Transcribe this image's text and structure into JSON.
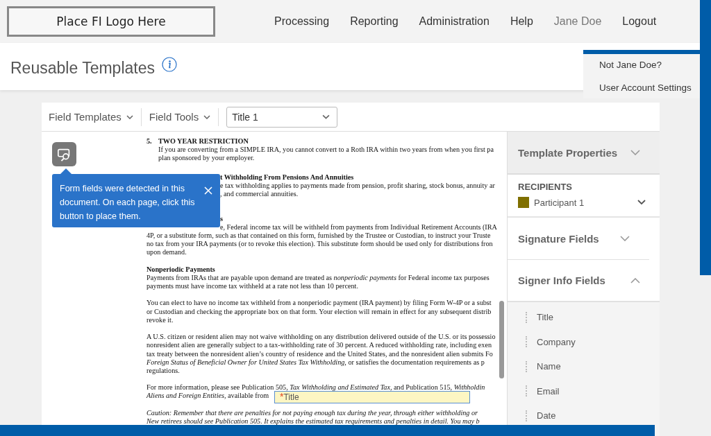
{
  "logo": "Place FI Logo Here",
  "nav": [
    {
      "label": "Processing",
      "selected": false
    },
    {
      "label": "Reporting",
      "selected": false
    },
    {
      "label": "Administration",
      "selected": false
    },
    {
      "label": "Help",
      "selected": false
    },
    {
      "label": "Jane Doe",
      "selected": true
    },
    {
      "label": "Logout",
      "selected": false
    }
  ],
  "user_menu": [
    "Not Jane Doe?",
    "User Account Settings"
  ],
  "page_title": "Reusable Templates",
  "toolbar": {
    "menus": [
      "Field Templates",
      "Field Tools"
    ],
    "select_value": "Title 1"
  },
  "detect_tip": "Form fields were detected in this document. On each page, click this button to place them.",
  "document": [
    {
      "lines": [
        {
          "kind": "heading",
          "num": "5.",
          "text": "TWO YEAR RESTRICTION"
        },
        {
          "kind": "indent",
          "text": "If you are converting from a SIMPLE IRA, you cannot convert to a Roth IRA within two years from when you first pa"
        },
        {
          "kind": "indent",
          "text": "plan sponsored by your employer."
        }
      ]
    },
    {
      "lines": [
        {
          "kind": "covered-bold",
          "text": "t Withholding From Pensions And Annuities"
        },
        {
          "kind": "covered",
          "text": "e tax withholding applies to payments made from pension, profit sharing, stock bonus, annuity ar"
        },
        {
          "kind": "covered",
          "text": ", and commercial annuities."
        }
      ]
    },
    {
      "lines": [
        {
          "kind": "covered-bold",
          "text": "s"
        },
        {
          "kind": "covered",
          "text": "e, Federal income tax will be withheld from payments from Individual Retirement Accounts (IRA"
        },
        {
          "kind": "plain",
          "text": "4P, or a substitute form, such as that contained on this form, furnished by the Trustee or Custodian, to instruct your Truste"
        },
        {
          "kind": "plain",
          "text": "no tax from your IRA payments (or to revoke this election). This substitute form should be used only for distributions fron"
        },
        {
          "kind": "plain",
          "text": "upon demand."
        }
      ]
    },
    {
      "lines": [
        {
          "kind": "bold",
          "text": "Nonperiodic Payments"
        },
        {
          "kind": "plain",
          "text": "Payments from IRAs that are payable upon demand are treated as *nonperiodic payments* for Federal income tax purposes"
        },
        {
          "kind": "plain",
          "text": "payments must have income tax withheld at a rate not less than 10 percent."
        }
      ]
    },
    {
      "lines": [
        {
          "kind": "plain",
          "text": "You can elect to have no income tax withheld from a nonperiodic payment (IRA payment) by filing Form W-4P or a subst"
        },
        {
          "kind": "plain",
          "text": "or Custodian and checking the appropriate box on that form. Your election will remain in effect for any subsequent distrib"
        },
        {
          "kind": "plain",
          "text": "revoke it."
        }
      ]
    },
    {
      "lines": [
        {
          "kind": "plain",
          "text": "A U.S. citizen or resident alien may not waive withholding on any distribution delivered outside of the U.S. or its possessio"
        },
        {
          "kind": "plain",
          "text": "nonresident alien are generally subject to a tax-withholding rate of 30 percent. A reduced withholding rate, including exen"
        },
        {
          "kind": "plain",
          "text": "tax treaty between the nonresident alien’s country of residence and the United States, and the nonresident alien submits Fo"
        },
        {
          "kind": "plain",
          "text": "*Foreign Status of Beneficial Owner for United States Tax Withholding,* or satisfies the documentation requirements as p"
        },
        {
          "kind": "plain",
          "text": "regulations."
        }
      ]
    },
    {
      "lines": [
        {
          "kind": "plain",
          "text": "For more information, please see Publication 505, *Tax Withholding and Estimated Tax*, and Publication 515, *Withholdin*"
        },
        {
          "kind": "plain",
          "text": "*Aliens and Foreign Entities*, available from"
        }
      ]
    },
    {
      "lines": [
        {
          "kind": "italic",
          "text": "Caution: Remember that there are penalties for not paying enough tax during the year, through either withholding or"
        },
        {
          "kind": "italic",
          "text": "New retirees should see Publication 505. It explains the estimated tax requirements and penalties in detail. You may b"
        }
      ]
    }
  ],
  "placed_field": {
    "marker": "*",
    "label": "Title"
  },
  "sidebar": {
    "template_properties": {
      "title": "Template Properties",
      "expanded": false
    },
    "recipients": {
      "heading": "RECIPIENTS",
      "name": "Participant 1",
      "color": "#7f6f00"
    },
    "sections": [
      {
        "title": "Signature Fields",
        "expanded": false
      },
      {
        "title": "Signer Info Fields",
        "expanded": true
      }
    ],
    "fields": [
      "Title",
      "Company",
      "Name",
      "Email",
      "Date"
    ]
  }
}
